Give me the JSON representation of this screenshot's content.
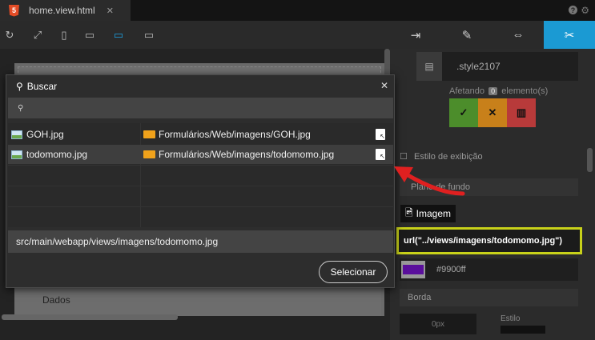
{
  "tab": {
    "icon": "html5-icon",
    "badge": "5",
    "title": "home.view.html",
    "close": "✕"
  },
  "window_icons": {
    "help": "?",
    "gear": "⚙"
  },
  "toolbar": {
    "buttons": [
      {
        "name": "refresh-icon",
        "glyph": "↻"
      },
      {
        "name": "fullscreen-icon",
        "glyph": "⤢"
      },
      {
        "name": "phone-icon",
        "glyph": "▯"
      },
      {
        "name": "tablet-icon",
        "glyph": "▭"
      },
      {
        "name": "desktop-icon",
        "glyph": "▭"
      },
      {
        "name": "monitor-icon",
        "glyph": "▭"
      }
    ],
    "active_color": "#1ba1e2"
  },
  "right_tabs": [
    {
      "name": "login-icon",
      "glyph": "⇥"
    },
    {
      "name": "pencil-icon",
      "glyph": "✎"
    },
    {
      "name": "resize-icon",
      "glyph": "⇔"
    },
    {
      "name": "brush-icon",
      "glyph": "✂"
    }
  ],
  "canvas": {
    "dados_label": "Dados"
  },
  "dialog": {
    "title": "Buscar",
    "close": "✕",
    "search_placeholder": "",
    "results": [
      {
        "name": "GOH.jpg",
        "path": "Formulários/Web/imagens/GOH.jpg",
        "selected": false
      },
      {
        "name": "todomomo.jpg",
        "path": "Formulários/Web/imagens/todomomo.jpg",
        "selected": true
      }
    ],
    "selected_path": "src/main/webapp/views/imagens/todomomo.jpg",
    "select_label": "Selecionar"
  },
  "panel": {
    "style_name": ".style2107",
    "afetando_prefix": "Afetando",
    "afetando_count": "0",
    "afetando_suffix": "elemento(s)",
    "display_label": "Estilo de exibição",
    "background_label": "Plano de fundo",
    "image_label": "Imagem",
    "url_value": "url(\"../views/imagens/todomomo.jpg\")",
    "color_value": "#9900ff",
    "border_label": "Borda",
    "border_width": "0px",
    "estilo_label": "Estilo"
  },
  "colors": {
    "accent": "#1b9ad3",
    "url_highlight": "#c8d11a",
    "swatch": "#5a0f9c",
    "arrow": "#e02020"
  }
}
